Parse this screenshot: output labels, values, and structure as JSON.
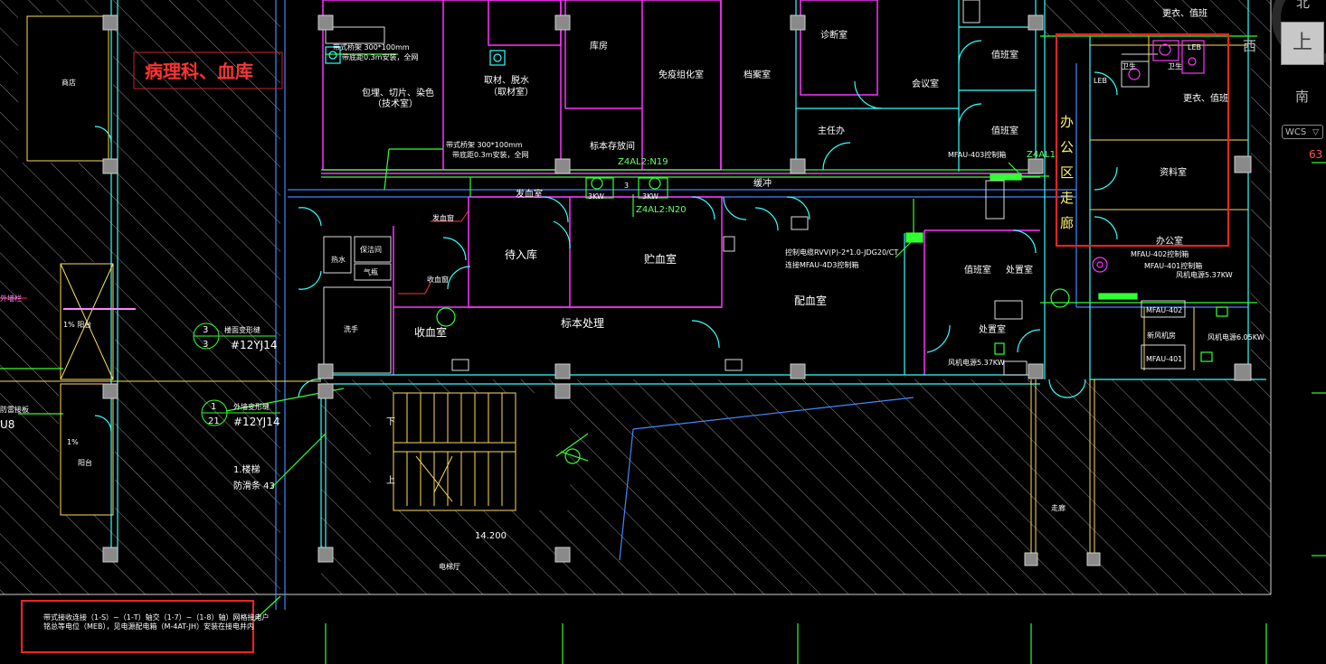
{
  "drawing": {
    "department_title": "病理科、血库",
    "office_area_label": [
      "办",
      "公",
      "区",
      "走",
      "廊"
    ],
    "note_lines": [
      "带式接收连接（1-S）~（1-T）轴交（1-7）~（1-8）轴）网格接电户",
      "铭总等电位（MEB），见电源配电箱（M-4AT-JH）安装在接电井内"
    ],
    "rooms": {
      "packaging": "包埋、切片、染色",
      "packaging_sub": "（技术室）",
      "sampling": "取材、脱水",
      "sampling_sub": "（取材室）",
      "storage": "库房",
      "immuno": "免疫组化室",
      "archive": "档案室",
      "specimen_store": "标本存放间",
      "meeting": "会议室",
      "duty_top": "值班室",
      "duty_mid": "值班室",
      "director": "主任办",
      "lab_office": "诊断室",
      "blood_issue": "发血室",
      "buffer": "缓冲",
      "to_store": "待入库",
      "blood_store": "贮血室",
      "specimen_proc": "标本处理",
      "blood_collect": "收血室",
      "blood_dispense": "配血室",
      "duty_low": "值班室",
      "disposal": "处置室",
      "disposal_low": "处置室",
      "changing_top": "更衣、值班",
      "changing": "更衣、值班",
      "records": "资料室",
      "office": "办公室",
      "shop": "商店",
      "corridor": "走廊",
      "electrical": "电梯厅",
      "water": "热水",
      "closet": "保洁间",
      "gas": "气瓶",
      "sink": "洗手",
      "rest": "收血窗",
      "rest2": "发血窗",
      "balcony1": "阳台",
      "balcony2": "阳台",
      "slope1": "1% 阳台",
      "slope2": "1%"
    },
    "annotations": {
      "tray_top": "带式桥架 300*100mm",
      "tray_top_sub": "带底距0.3m安装，全网",
      "tray_mid": "带式桥架 300*100mm",
      "tray_mid_sub": "带底距0.3m安装，全网",
      "z4al2_n19": "Z4AL2:N19",
      "z4al2_n20": "Z4AL2:N20",
      "z4al1": "Z4AL1",
      "mfau403": "MFAU-403控制箱",
      "mfau402": "MFAU-402控制箱",
      "mfau401": "MFAU-401控制箱",
      "cable_spec": "控制电缆RVV(P)-2*1.0-JDG20/CT",
      "cable_spec2": "连接MFAU-4D3控制箱",
      "fan_power1": "风机电源5.37KW",
      "fan_power2": "风机电源5.37KW",
      "fan_power3": "风机电源6.05KW",
      "fan_power4": "风机电源5.37KW",
      "kw1": "3KW",
      "kw2": "3",
      "kw3": "3KW",
      "detail_ref1_num": "3",
      "detail_ref1_den": "3",
      "detail_ref1_title": "楼面变形缝",
      "detail_ref1_std": "#12YJ14",
      "detail_ref2_num": "1",
      "detail_ref2_den": "21",
      "detail_ref2_title": "外墙变形缝",
      "detail_ref2_std": "#12YJ14",
      "stair_note": "1.楼梯",
      "stair_note2": "防滑条 43",
      "elevation": "14.200",
      "stair_down": "下",
      "stair_up": "上",
      "nearby_left": "外墙栏",
      "nearby_left2": "防雷接板",
      "nearby_left3": "U8",
      "equip_a": "MFAU-402",
      "equip_b": "新风机房",
      "equip_c": "MFAU-401",
      "le": "LEB",
      "le2": "LEB",
      "wc1": "卫生",
      "wc2": "卫生"
    }
  },
  "viewcube": {
    "face_label": "上",
    "north": "北",
    "west": "西",
    "south": "南",
    "wcs_label": "WCS",
    "wcs_chevron": "▽"
  },
  "coordinate_readout": "63",
  "colors": {
    "background": "#000000",
    "wall_magenta": "#ff33ff",
    "wall_cyan": "#33ffff",
    "line_green": "#33ff33",
    "line_yellow": "#ffdd55",
    "highlight_red": "#ff2222",
    "hatch_white": "#9a9a9a",
    "axis_blue": "#4488ff"
  }
}
